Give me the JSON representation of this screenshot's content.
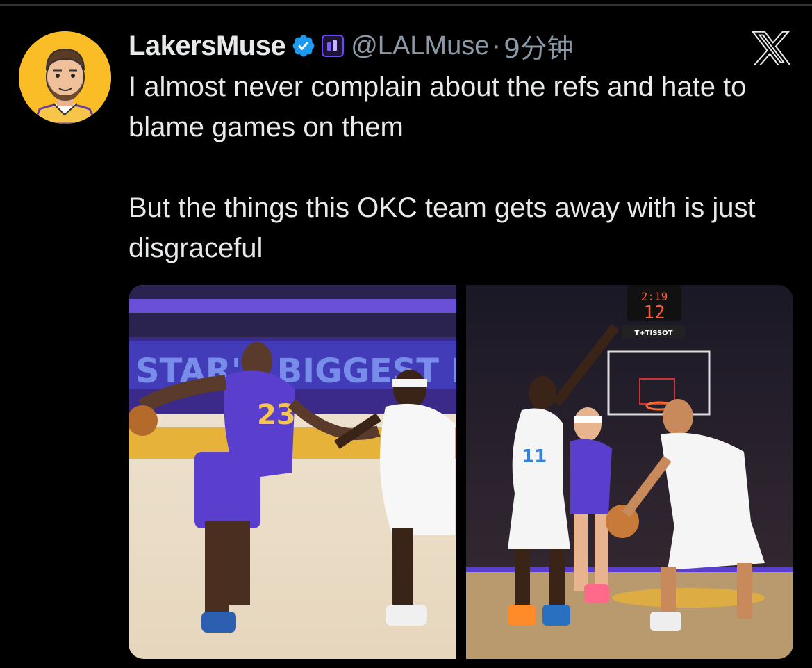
{
  "tweet": {
    "author": {
      "display_name": "LakersMuse",
      "handle": "@LALMuse",
      "verified": true,
      "affiliate_badge_icon": "affiliate-logo-icon"
    },
    "separator": "·",
    "timestamp": "9分钟",
    "text_lines": [
      "I almost never complain about the refs and hate to blame games on them",
      "But the things this OKC team gets away with is just disgraceful"
    ],
    "media": {
      "images": [
        {
          "icon": "basketball-photo-left",
          "alt": ""
        },
        {
          "icon": "basketball-photo-right",
          "alt": "",
          "scoreboard_time": "2:19",
          "shot_clock": "12",
          "sponsor": "TISSOT"
        }
      ]
    }
  },
  "app": {
    "logo_icon": "x-logo-icon"
  },
  "colors": {
    "background": "#000000",
    "text_primary": "#e7e9ea",
    "text_secondary": "#8b98a5",
    "verified_blue": "#1d9bf0",
    "avatar_bg": "#fbbd25"
  }
}
